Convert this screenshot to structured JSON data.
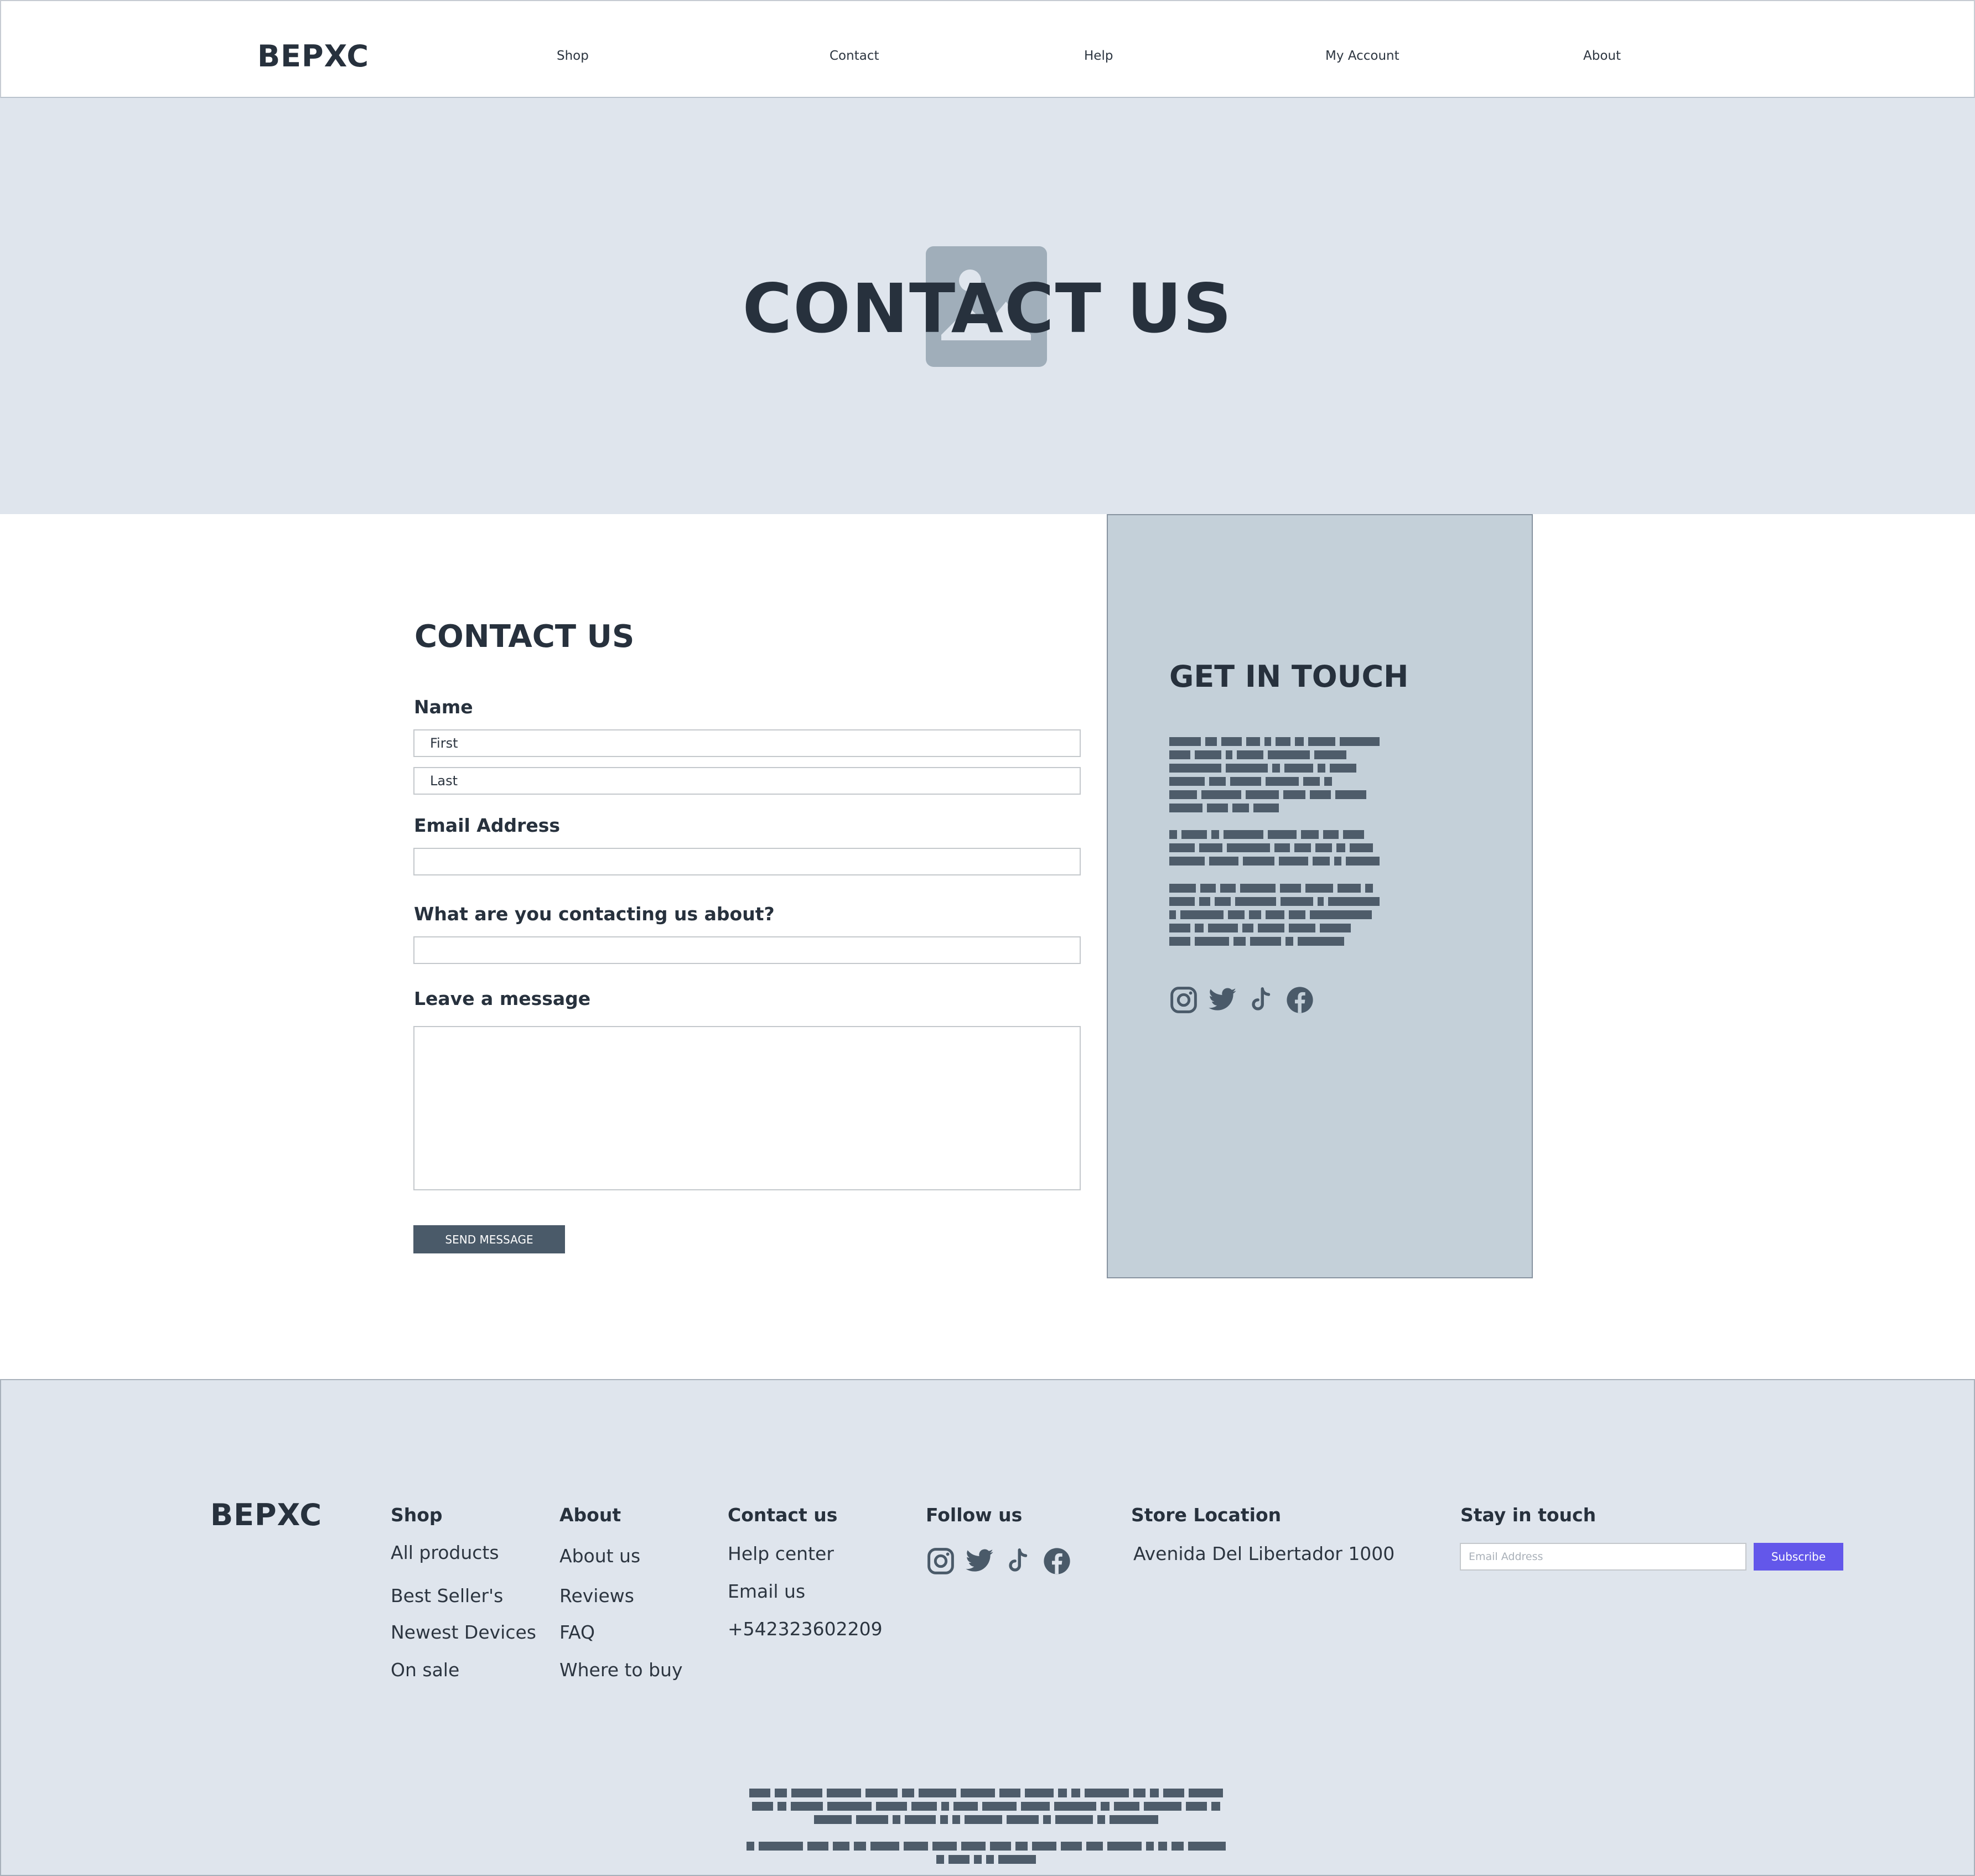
{
  "header": {
    "logo": "BEPXC",
    "nav": [
      "Shop",
      "Contact",
      "Help",
      "My Account",
      "About"
    ]
  },
  "hero": {
    "title": "CONTACT US"
  },
  "form": {
    "title": "CONTACT US",
    "name_label": "Name",
    "first_placeholder": "First",
    "last_placeholder": "Last",
    "email_label": "Email Address",
    "subject_label": "What are you contacting us about?",
    "message_label": "Leave a message",
    "send_label": "SEND MESSAGE"
  },
  "touch": {
    "title": "GET IN TOUCH",
    "socials": [
      "instagram-icon",
      "twitter-icon",
      "tiktok-icon",
      "facebook-icon"
    ]
  },
  "footer": {
    "logo": "BEPXC",
    "shop": {
      "heading": "Shop",
      "links": [
        "All products",
        "Best Seller's",
        "Newest Devices",
        "On sale"
      ]
    },
    "about": {
      "heading": "About",
      "links": [
        "About us",
        "Reviews",
        "FAQ",
        "Where to buy"
      ]
    },
    "contact": {
      "heading": "Contact us",
      "links": [
        "Help center",
        "Email us",
        "+542323602209"
      ]
    },
    "follow": {
      "heading": "Follow us"
    },
    "location": {
      "heading": "Store Location",
      "address": "Avenida Del Libertador 1000"
    },
    "stay": {
      "heading": "Stay in touch",
      "email_placeholder": "Email Address",
      "subscribe_label": "Subscribe"
    }
  },
  "colors": {
    "text": "#27313d",
    "hero_bg": "#dfe5ed",
    "panel_bg": "#c4d0d9",
    "button": "#4a5a69",
    "subscribe": "#6357ea",
    "placeholder_image": "#a0aeba"
  }
}
